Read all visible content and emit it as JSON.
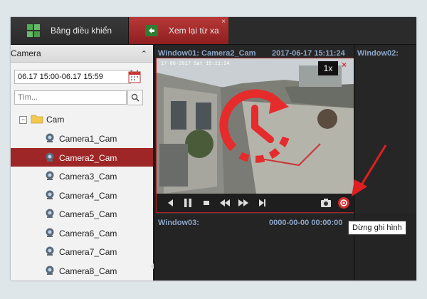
{
  "tabs": [
    {
      "label": "Bảng điều khiển",
      "icon": "grid-icon"
    },
    {
      "label": "Xem lại từ xa",
      "icon": "playback-return-icon",
      "close": "×"
    }
  ],
  "sidebar": {
    "title": "Camera",
    "collapse_glyph": "⌃",
    "date_range": "06.17 15:00-06.17 15:59",
    "search_placeholder": "Tìm...",
    "tree_root": {
      "toggle": "−",
      "label": "Cam"
    },
    "cameras": [
      {
        "label": "Camera1_Cam",
        "selected": false
      },
      {
        "label": "Camera2_Cam",
        "selected": true
      },
      {
        "label": "Camera3_Cam",
        "selected": false
      },
      {
        "label": "Camera4_Cam",
        "selected": false
      },
      {
        "label": "Camera5_Cam",
        "selected": false
      },
      {
        "label": "Camera6_Cam",
        "selected": false
      },
      {
        "label": "Camera7_Cam",
        "selected": false
      },
      {
        "label": "Camera8_Cam",
        "selected": false
      }
    ]
  },
  "windows": {
    "w1": {
      "title": "Window01: Camera2_Cam",
      "time": "2017-06-17 15:11:24",
      "speed": "1x",
      "close": "×",
      "osd": "17-06-2017 Sat 15:11:24"
    },
    "w2": {
      "title": "Window02:"
    },
    "w3": {
      "title": "Window03:",
      "time": "0000-00-00 00:00:00"
    }
  },
  "tooltip": "Dừng ghi hình",
  "colors": {
    "accent_red": "#9e2626",
    "title_blue": "#8da6c8",
    "annotation_red": "#e02020"
  }
}
